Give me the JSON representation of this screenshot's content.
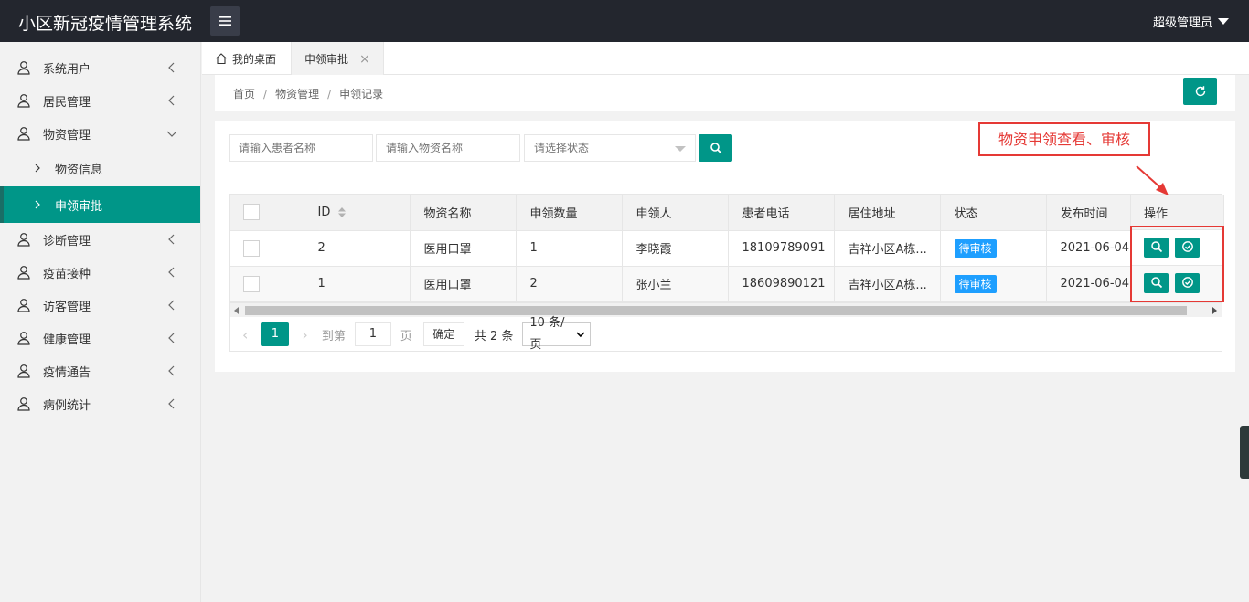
{
  "app": {
    "title": "小区新冠疫情管理系统",
    "user": "超级管理员"
  },
  "sidebar": {
    "items": [
      {
        "label": "系统用户",
        "icon": "user-icon"
      },
      {
        "label": "居民管理",
        "icon": "user-icon"
      },
      {
        "label": "物资管理",
        "icon": "user-icon",
        "expanded": true,
        "children": [
          {
            "label": "物资信息"
          },
          {
            "label": "申领审批",
            "active": true
          }
        ]
      },
      {
        "label": "诊断管理",
        "icon": "user-icon"
      },
      {
        "label": "疫苗接种",
        "icon": "user-icon"
      },
      {
        "label": "访客管理",
        "icon": "user-icon"
      },
      {
        "label": "健康管理",
        "icon": "user-icon"
      },
      {
        "label": "疫情通告",
        "icon": "user-icon"
      },
      {
        "label": "病例统计",
        "icon": "user-icon"
      }
    ]
  },
  "tabs": [
    {
      "label": "我的桌面"
    },
    {
      "label": "申领审批",
      "close": "×"
    }
  ],
  "breadcrumb": {
    "home": "首页",
    "section": "物资管理",
    "current": "申领记录",
    "separator": "/"
  },
  "search": {
    "patient_placeholder": "请输入患者名称",
    "material_placeholder": "请输入物资名称",
    "status_placeholder": "请选择状态"
  },
  "annotation": "物资申领查看、审核",
  "table": {
    "headers": [
      "ID",
      "物资名称",
      "申领数量",
      "申领人",
      "患者电话",
      "居住地址",
      "状态",
      "发布时间",
      "操作"
    ],
    "rows": [
      {
        "id": "2",
        "material": "医用口罩",
        "qty": "1",
        "applicant": "李晓霞",
        "phone": "18109789091",
        "address": "吉祥小区A栋...",
        "status": "待审核",
        "time": "2021-06-04 1..."
      },
      {
        "id": "1",
        "material": "医用口罩",
        "qty": "2",
        "applicant": "张小兰",
        "phone": "18609890121",
        "address": "吉祥小区A栋...",
        "status": "待审核",
        "time": "2021-06-04 1..."
      }
    ]
  },
  "pager": {
    "current": "1",
    "goto_label": "到第",
    "goto_value": "1",
    "page_unit": "页",
    "confirm": "确定",
    "total": "共 2 条",
    "page_size": "10 条/页"
  },
  "colors": {
    "primary": "#009688",
    "header": "#23262e",
    "badge": "#1e9fff",
    "annotation": "#e53935"
  }
}
